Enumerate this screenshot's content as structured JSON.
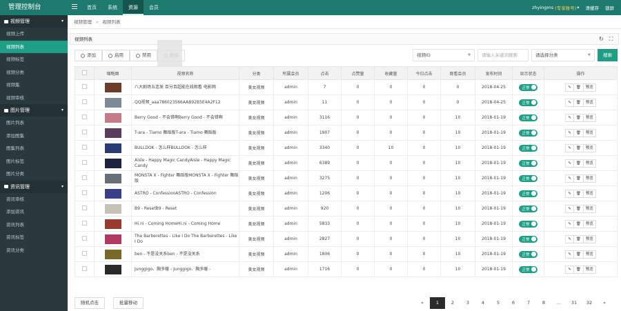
{
  "header": {
    "logo": "管理控制台",
    "nav": [
      "首页",
      "系统",
      "资源",
      "会员"
    ],
    "active_nav": 2,
    "user": "zhyingms",
    "account": "(专享账号)",
    "caret": "▾",
    "links": [
      "清缓存",
      "锁屏"
    ]
  },
  "sidebar": [
    {
      "group": "视频管理",
      "items": [
        "视频上传",
        "视频列表",
        "视频标签",
        "视频分类",
        "视频集",
        "视频审核"
      ]
    },
    {
      "group": "图片管理",
      "items": [
        "图片列表",
        "添加图集",
        "图集列表",
        "图片标签",
        "图片分类"
      ]
    },
    {
      "group": "资讯管理",
      "items": [
        "资讯审核",
        "添加资讯",
        "资讯列表",
        "资讯标签",
        "资讯分类"
      ]
    }
  ],
  "sidebar_active": "视频列表",
  "breadcrumb": [
    "视频管理",
    "视频列表"
  ],
  "card_title": "视频列表",
  "toolbar": {
    "add": "添加",
    "enable": "启用",
    "disable": "禁用",
    "delete": "删除"
  },
  "filters": {
    "tag": "视频ID",
    "search_placeholder": "请输入关键词搜索",
    "category": "请选择分类",
    "search_btn": "搜索"
  },
  "columns": [
    "",
    "缩略图",
    "视频名称",
    "分类",
    "所属会员",
    "点击",
    "点赞量",
    "收藏量",
    "今日点击",
    "观看会员",
    "发布时间",
    "显示状态",
    "操作"
  ],
  "rows": [
    {
      "title": "八大剧场五连发 百分百超能在线观看 电影网",
      "cat": "美女视频",
      "owner": "admin",
      "clicks": "7",
      "likes": "0",
      "fav": "0",
      "today": "0",
      "watch": "0",
      "time": "2018-04-25",
      "status": "正常"
    },
    {
      "title": "QQ视频_aaa786023566AAB92B5E4A2F12",
      "cat": "美女视频",
      "owner": "admin",
      "clicks": "11",
      "likes": "0",
      "fav": "0",
      "today": "0",
      "watch": "0",
      "time": "2018-04-25",
      "status": "正常"
    },
    {
      "title": "Berry Good - 不会错啊Berry Good - 不会错啊",
      "cat": "美女视频",
      "owner": "admin",
      "clicks": "3116",
      "likes": "0",
      "fav": "0",
      "today": "0",
      "watch": "10",
      "time": "2018-01-19",
      "status": "正常"
    },
    {
      "title": "T-ara - Tiamo 舞蹈版T-ara - Tiamo 舞蹈版",
      "cat": "美女视频",
      "owner": "admin",
      "clicks": "1907",
      "likes": "0",
      "fav": "0",
      "today": "0",
      "watch": "10",
      "time": "2018-01-19",
      "status": "正常"
    },
    {
      "title": "BULLDOK - 怎么样BULLDOK - 怎么样",
      "cat": "美女视频",
      "owner": "admin",
      "clicks": "3340",
      "likes": "0",
      "fav": "10",
      "today": "0",
      "watch": "10",
      "time": "2018-01-19",
      "status": "正常"
    },
    {
      "title": "Aisle - Happy Magic CandyAisle - Happy Magic Candy",
      "cat": "美女视频",
      "owner": "admin",
      "clicks": "6389",
      "likes": "0",
      "fav": "0",
      "today": "0",
      "watch": "10",
      "time": "2018-01-19",
      "status": "正常"
    },
    {
      "title": "MONSTA X - Fighter 舞蹈版MONSTA X - Fighter 舞蹈版",
      "cat": "美女视频",
      "owner": "admin",
      "clicks": "3275",
      "likes": "0",
      "fav": "0",
      "today": "0",
      "watch": "10",
      "time": "2018-01-19",
      "status": "正常"
    },
    {
      "title": "ASTRO - ConfessionASTRO - Confession",
      "cat": "美女视频",
      "owner": "admin",
      "clicks": "1206",
      "likes": "0",
      "fav": "0",
      "today": "0",
      "watch": "10",
      "time": "2018-01-19",
      "status": "正常"
    },
    {
      "title": "B9 - ResetB9 - Reset",
      "cat": "美女视频",
      "owner": "admin",
      "clicks": "920",
      "likes": "0",
      "fav": "0",
      "today": "0",
      "watch": "10",
      "time": "2018-01-19",
      "status": "正常"
    },
    {
      "title": "Hi.ni - Coming HomeHi.ni - Coming Home",
      "cat": "美女视频",
      "owner": "admin",
      "clicks": "5833",
      "likes": "0",
      "fav": "0",
      "today": "0",
      "watch": "10",
      "time": "2018-01-19",
      "status": "正常"
    },
    {
      "title": "The Barberettes - Like I Do The Barberettes - Like I Do",
      "cat": "美女视频",
      "owner": "admin",
      "clicks": "2827",
      "likes": "0",
      "fav": "0",
      "today": "0",
      "watch": "10",
      "time": "2018-01-19",
      "status": "正常"
    },
    {
      "title": "ben - 不是没关系ben - 不是没关系",
      "cat": "美女视频",
      "owner": "admin",
      "clicks": "1806",
      "likes": "0",
      "fav": "0",
      "today": "0",
      "watch": "10",
      "time": "2018-01-19",
      "status": "正常"
    },
    {
      "title": "Junggigo、胸多暖 - Junggigo、胸多暖 -",
      "cat": "美女视频",
      "owner": "admin",
      "clicks": "1716",
      "likes": "0",
      "fav": "0",
      "today": "0",
      "watch": "10",
      "time": "2018-01-19",
      "status": "正常"
    }
  ],
  "ops": {
    "edit": "✎",
    "del": "🗑",
    "preview": "预览"
  },
  "footer": {
    "random_click": "随机点击",
    "batch_move": "批量移动"
  },
  "pager": {
    "prev": "«",
    "pages": [
      "1",
      "2",
      "3",
      "4",
      "5",
      "6",
      "7",
      "8",
      "...",
      "31",
      "32"
    ],
    "next": "»",
    "active": "1"
  },
  "thumb_colors": [
    "#6b3d2a",
    "#7b8a96",
    "#c47a88",
    "#5a3d5c",
    "#2a3b73",
    "#1e2240",
    "#6a6f77",
    "#3a3f8a",
    "#c6c2b8",
    "#9b3a2e",
    "#b23a62",
    "#7a6a2a",
    "#2a2a2a"
  ],
  "colors": {
    "accent": "#1e9e86",
    "topbar": "#1e7a6e",
    "sidebar": "#2a393d"
  }
}
